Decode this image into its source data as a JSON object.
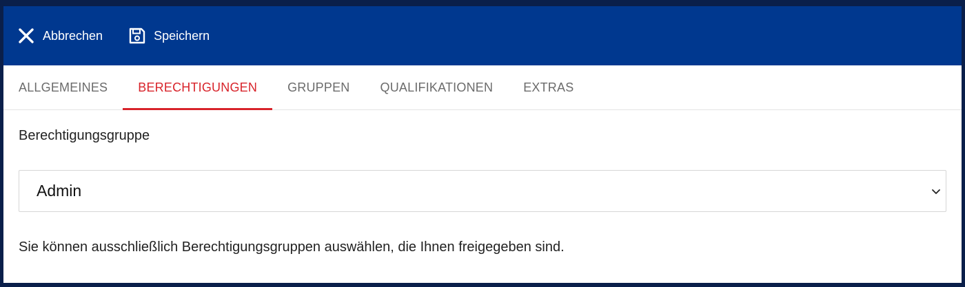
{
  "toolbar": {
    "cancel_label": "Abbrechen",
    "save_label": "Speichern",
    "cancel_icon": "close-icon",
    "save_icon": "save-icon",
    "background": "#00388f"
  },
  "tabs": [
    {
      "label": "ALLGEMEINES",
      "active": false
    },
    {
      "label": "BERECHTIGUNGEN",
      "active": true
    },
    {
      "label": "GRUPPEN",
      "active": false
    },
    {
      "label": "QUALIFIKATIONEN",
      "active": false
    },
    {
      "label": "EXTRAS",
      "active": false
    }
  ],
  "accent_color": "#d8232a",
  "form": {
    "label": "Berechtigungsgruppe",
    "selected_value": "Admin",
    "hint": "Sie können ausschließlich Berechtigungsgruppen auswählen, die Ihnen freigegeben sind."
  }
}
